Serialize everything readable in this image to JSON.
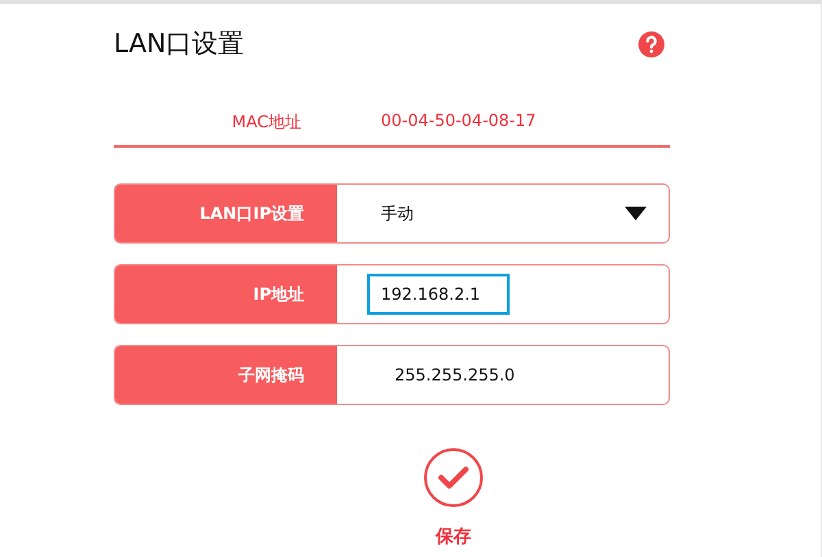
{
  "title": "LAN口设置",
  "mac": {
    "label": "MAC地址",
    "value": "00-04-50-04-08-17"
  },
  "fields": [
    {
      "kind": "select",
      "label": "LAN口IP设置",
      "value": "手动"
    },
    {
      "kind": "text",
      "label": "IP地址",
      "value": "192.168.2.1",
      "highlighted": true
    },
    {
      "kind": "text",
      "label": "子网掩码",
      "value": "255.255.255.0",
      "highlighted": false
    }
  ],
  "save": {
    "label": "保存"
  }
}
